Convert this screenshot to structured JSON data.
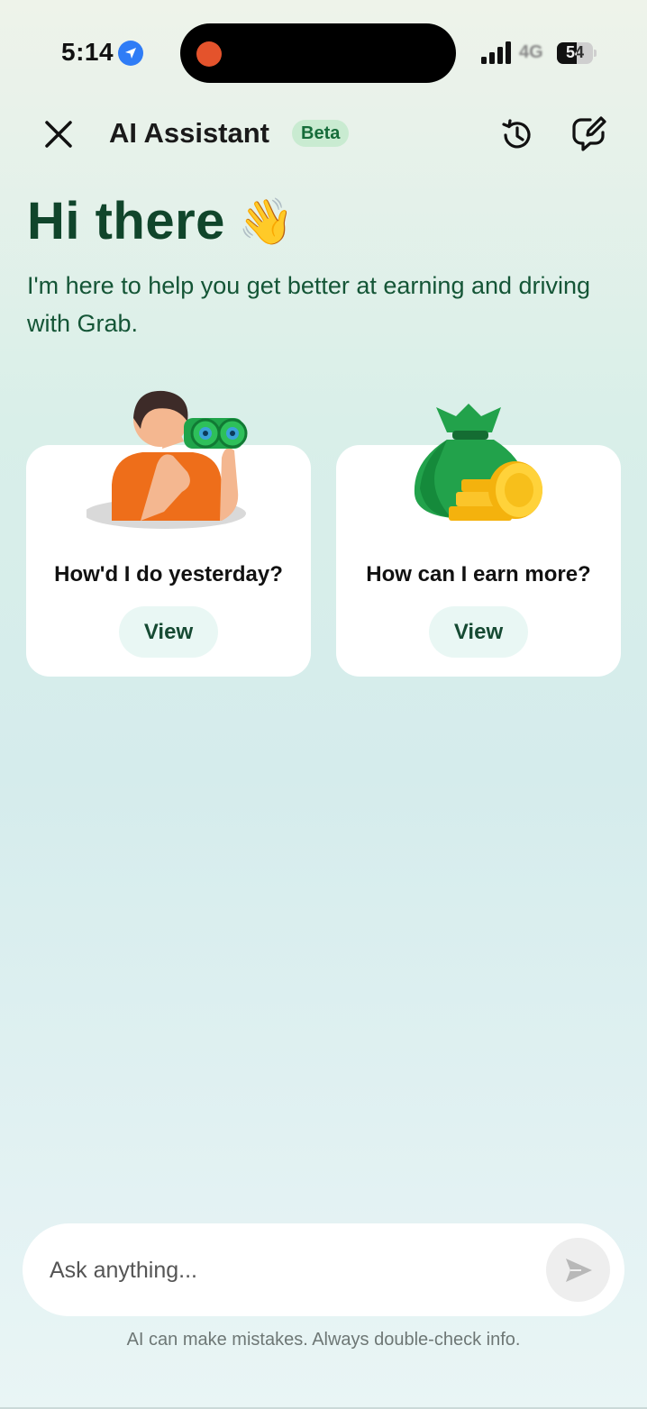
{
  "status_bar": {
    "time": "5:14",
    "network": "4G",
    "battery": "54",
    "battery_level": 0.54
  },
  "header": {
    "title": "AI Assistant",
    "badge": "Beta"
  },
  "greeting": {
    "title": "Hi there",
    "emoji": "👋",
    "subtitle": "I'm here to help you get better at earning and driving with Grab."
  },
  "cards": [
    {
      "title": "How'd I do yesterday?",
      "button": "View",
      "icon": "binoculars-person-illustration"
    },
    {
      "title": "How can I earn more?",
      "button": "View",
      "icon": "money-bag-coins-illustration"
    }
  ],
  "input": {
    "placeholder": "Ask anything..."
  },
  "disclaimer": "AI can make mistakes. Always double-check info.",
  "colors": {
    "brand_dark_green": "#10452b",
    "beta_bg": "#c9ebd1",
    "beta_text": "#166c3a",
    "view_button_bg": "#e9f7f4"
  }
}
